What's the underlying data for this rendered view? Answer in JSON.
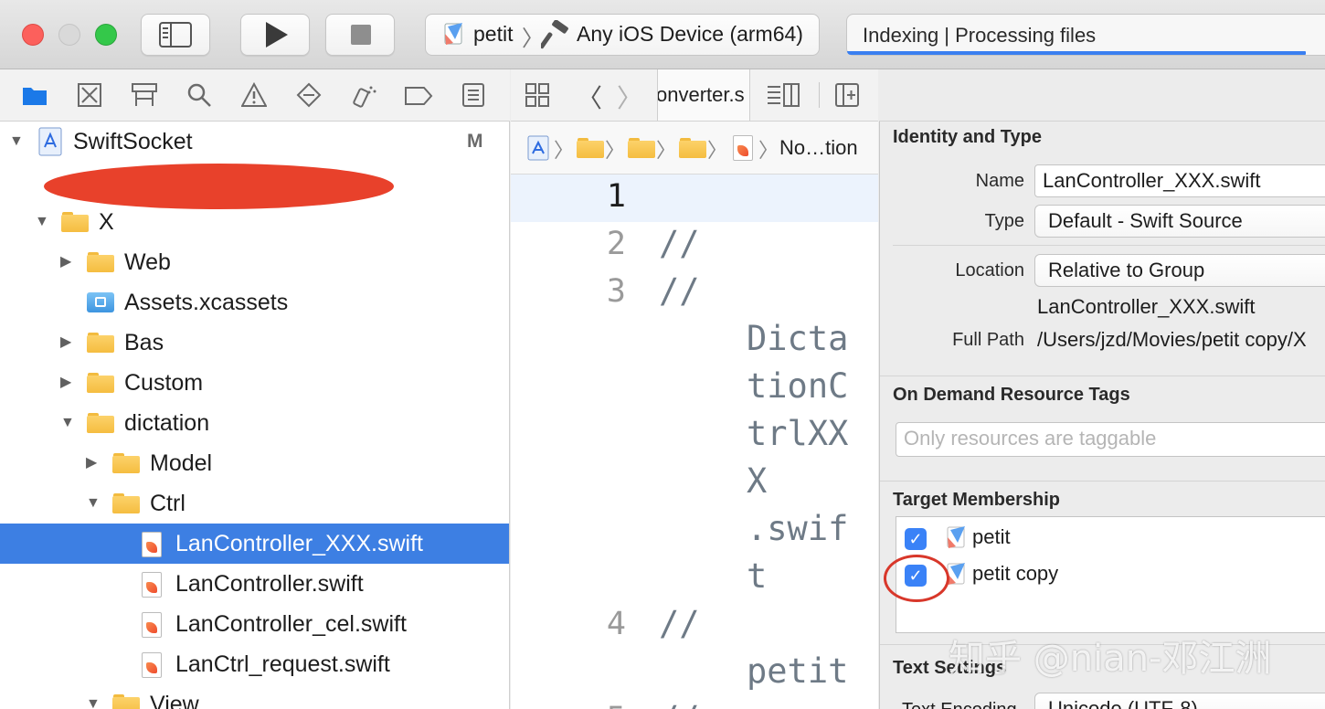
{
  "toolbar": {
    "scheme_name": "petit",
    "destination": "Any iOS Device (arm64)",
    "activity_status": "Indexing | Processing files"
  },
  "editor": {
    "tab_label": "onverter.s",
    "breadcrumb_last": "No…tion",
    "lines": [
      {
        "num": "1",
        "text": ""
      },
      {
        "num": "2",
        "text": "//"
      },
      {
        "num": "3",
        "text": "//"
      },
      {
        "num": "",
        "text": "Dicta"
      },
      {
        "num": "",
        "text": "tionC"
      },
      {
        "num": "",
        "text": "trlXX"
      },
      {
        "num": "",
        "text": "X"
      },
      {
        "num": "",
        "text": ".swif"
      },
      {
        "num": "",
        "text": "t"
      },
      {
        "num": "4",
        "text": "//"
      },
      {
        "num": "",
        "text": "petit"
      },
      {
        "num": "5",
        "text": "//"
      }
    ]
  },
  "navigator": {
    "project": {
      "name": "SwiftSocket",
      "badge": "M"
    },
    "items": [
      {
        "label": "X"
      },
      {
        "label": "Web"
      },
      {
        "label": "Assets.xcassets"
      },
      {
        "label": "Bas"
      },
      {
        "label": "Custom"
      },
      {
        "label": "dictation"
      },
      {
        "label": "Model"
      },
      {
        "label": "Ctrl"
      },
      {
        "label": "LanController_XXX.swift"
      },
      {
        "label": "LanController.swift"
      },
      {
        "label": "LanController_cel.swift"
      },
      {
        "label": "LanCtrl_request.swift"
      },
      {
        "label": "View"
      }
    ]
  },
  "inspector": {
    "identity": {
      "heading": "Identity and Type",
      "name_label": "Name",
      "name_value": "LanController_XXX.swift",
      "type_label": "Type",
      "type_value": "Default - Swift Source",
      "location_label": "Location",
      "location_value": "Relative to Group",
      "location_file": "LanController_XXX.swift",
      "full_path_label": "Full Path",
      "full_path_value": "/Users/jzd/Movies/petit copy/X"
    },
    "tags": {
      "heading": "On Demand Resource Tags",
      "placeholder": "Only resources are taggable"
    },
    "membership": {
      "heading": "Target Membership",
      "targets": [
        {
          "name": "petit",
          "checked": true
        },
        {
          "name": "petit copy",
          "checked": true
        }
      ]
    },
    "text_settings": {
      "heading": "Text Settings",
      "encoding_label": "Text Encoding",
      "encoding_value": "Unicode (UTF-8)"
    }
  },
  "watermark": "知乎 @nian-邓江洲",
  "colors": {
    "selection": "#3d7fe3",
    "annotation_red": "#e8412b",
    "checkbox_blue": "#3a82f7",
    "close": "#fc605c",
    "minimize_disabled": "#d9d9d9",
    "zoom": "#34c84a"
  }
}
